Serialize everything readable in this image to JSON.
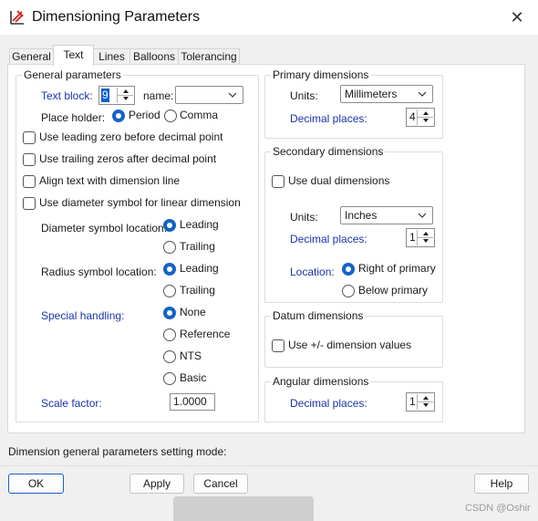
{
  "window": {
    "title": "Dimensioning Parameters",
    "app_icon": "dimension-icon",
    "close_glyph": "✕"
  },
  "tabs": [
    {
      "label": "General",
      "active": false
    },
    {
      "label": "Text",
      "active": true
    },
    {
      "label": "Lines",
      "active": false
    },
    {
      "label": "Balloons",
      "active": false
    },
    {
      "label": "Tolerancing",
      "active": false
    }
  ],
  "general": {
    "title": "General parameters",
    "text_block_label": "Text block:",
    "text_block_value": "9",
    "name_label": "name:",
    "name_value": "",
    "place_holder_label": "Place holder:",
    "place_holder_options": [
      "Period",
      "Comma"
    ],
    "place_holder_selected": "Period",
    "checkboxes": [
      {
        "label": "Use leading zero before decimal point",
        "checked": false
      },
      {
        "label": "Use trailing zeros after decimal point",
        "checked": false
      },
      {
        "label": "Align text with dimension line",
        "checked": false
      },
      {
        "label": "Use diameter symbol for linear dimension",
        "checked": false
      }
    ],
    "diameter_label": "Diameter symbol location:",
    "diameter_options": [
      "Leading",
      "Trailing"
    ],
    "diameter_selected": "Leading",
    "radius_label": "Radius symbol location:",
    "radius_options": [
      "Leading",
      "Trailing"
    ],
    "radius_selected": "Leading",
    "special_label": "Special handling:",
    "special_options": [
      "None",
      "Reference",
      "NTS",
      "Basic"
    ],
    "special_selected": "None",
    "scale_label": "Scale factor:",
    "scale_value": "1.0000"
  },
  "primary": {
    "title": "Primary dimensions",
    "units_label": "Units:",
    "units_value": "Millimeters",
    "decimal_label": "Decimal places:",
    "decimal_value": "4"
  },
  "secondary": {
    "title": "Secondary dimensions",
    "dual_label": "Use dual dimensions",
    "dual_checked": false,
    "units_label": "Units:",
    "units_value": "Inches",
    "decimal_label": "Decimal places:",
    "decimal_value": "1",
    "location_label": "Location:",
    "location_options": [
      "Right of primary",
      "Below primary"
    ],
    "location_selected": "Right of primary"
  },
  "datum": {
    "title": "Datum dimensions",
    "checkbox_label": "Use +/- dimension values",
    "checked": false
  },
  "angular": {
    "title": "Angular dimensions",
    "decimal_label": "Decimal places:",
    "decimal_value": "1"
  },
  "status_text": "Dimension general parameters setting mode:",
  "buttons": {
    "ok": "OK",
    "apply": "Apply",
    "cancel": "Cancel",
    "help": "Help"
  },
  "watermark": "CSDN @Oshir",
  "colors": {
    "accent": "#1463c4",
    "label_blue": "#1a33aa",
    "selection": "#0b5fd1"
  }
}
